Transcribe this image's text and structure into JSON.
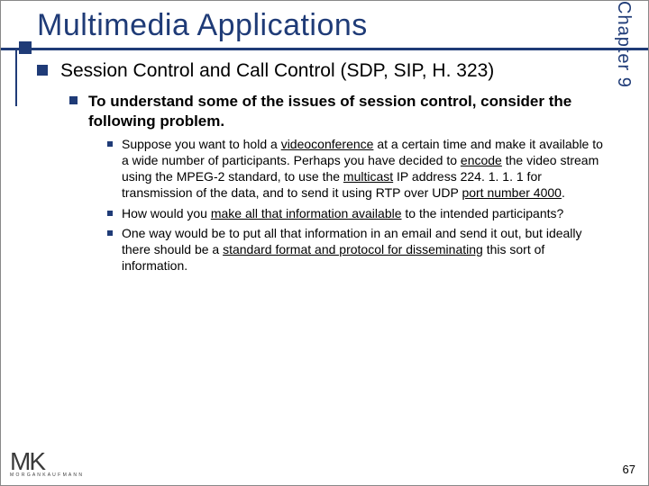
{
  "chapter_label": "Chapter 9",
  "title": "Multimedia Applications",
  "lvl1": "Session Control and Call Control (SDP, SIP, H. 323)",
  "lvl2": "To understand some of the issues of session control, consider the following problem.",
  "lvl3": [
    "Suppose you want to hold a <span class=\"u\">videoconference</span> at a certain time and make it available to a wide number of participants. Perhaps you have decided to <span class=\"u\">encode</span> the video stream using the MPEG-2 standard, to use the <span class=\"u\">multicast</span> IP address 224. 1. 1. 1 for transmission of the data, and to send it using RTP over UDP <span class=\"u\">port number 4000</span>.",
    "How would you <span class=\"u\">make all that information available</span> to the intended participants?",
    "One way would be to put all that information in an email and send it out, but ideally there should be a <span class=\"u\">standard format and protocol for disseminating</span> this sort of information."
  ],
  "logo_sub": "M O R G A N   K A U F M A N N",
  "page_number": "67"
}
